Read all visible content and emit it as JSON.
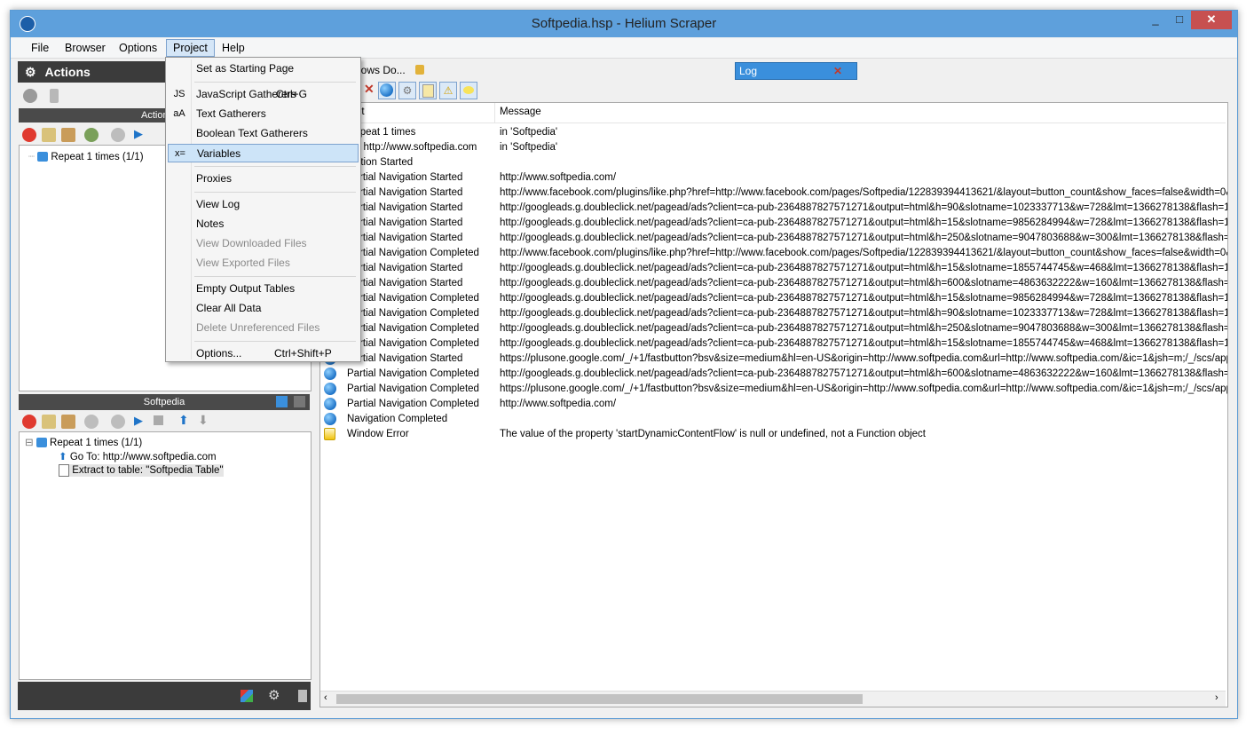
{
  "window": {
    "title": "Softpedia.hsp - Helium Scraper",
    "controls": {
      "minimize": "_",
      "maximize": "□",
      "close": "✕"
    }
  },
  "menubar": {
    "items": [
      "File",
      "Browser",
      "Options",
      "Project",
      "Help"
    ]
  },
  "left_panel": {
    "actions_title": "Actions",
    "tree_header": "Actions tre",
    "tree_items": [
      {
        "label": "Repeat 1 times (1/1)"
      }
    ],
    "sub_header": "Softpedia",
    "sub_tree": [
      {
        "label": "Repeat 1 times (1/1)"
      },
      {
        "label": "Go To: http://www.softpedia.com"
      },
      {
        "label": "Extract to table: \"Softpedia Table\""
      }
    ]
  },
  "tabs": [
    {
      "label": "dows Do..."
    },
    {
      "label": "Log"
    }
  ],
  "log": {
    "columns": {
      "event": "nt",
      "message": "Message"
    },
    "rows": [
      {
        "icon": "none",
        "event": "Repeat 1 times",
        "message": "in 'Softpedia'"
      },
      {
        "icon": "none",
        "event": "To: http://www.softpedia.com",
        "message": "in 'Softpedia'"
      },
      {
        "icon": "none",
        "event": "igation Started",
        "message": ""
      },
      {
        "icon": "globe",
        "event": "Partial Navigation Started",
        "message": "http://www.softpedia.com/"
      },
      {
        "icon": "globe",
        "event": "Partial Navigation Started",
        "message": "http://www.facebook.com/plugins/like.php?href=http://www.facebook.com/pages/Softpedia/122839394413621/&layout=button_count&show_faces=false&width=0&action"
      },
      {
        "icon": "globe",
        "event": "Partial Navigation Started",
        "message": "http://googleads.g.doubleclick.net/pagead/ads?client=ca-pub-2364887827571271&output=html&h=90&slotname=1023337713&w=728&lmt=1366278138&flash=11.7.700.16"
      },
      {
        "icon": "globe",
        "event": "Partial Navigation Started",
        "message": "http://googleads.g.doubleclick.net/pagead/ads?client=ca-pub-2364887827571271&output=html&h=15&slotname=9856284994&w=728&lmt=1366278138&flash=11.7.700.16"
      },
      {
        "icon": "globe",
        "event": "Partial Navigation Started",
        "message": "http://googleads.g.doubleclick.net/pagead/ads?client=ca-pub-2364887827571271&output=html&h=250&slotname=9047803688&w=300&lmt=1366278138&flash=11.7.700.1"
      },
      {
        "icon": "globe",
        "event": "Partial Navigation Completed",
        "message": "http://www.facebook.com/plugins/like.php?href=http://www.facebook.com/pages/Softpedia/122839394413621/&layout=button_count&show_faces=false&width=0&action"
      },
      {
        "icon": "globe",
        "event": "Partial Navigation Started",
        "message": "http://googleads.g.doubleclick.net/pagead/ads?client=ca-pub-2364887827571271&output=html&h=15&slotname=1855744745&w=468&lmt=1366278138&flash=11.7.700.16"
      },
      {
        "icon": "globe",
        "event": "Partial Navigation Started",
        "message": "http://googleads.g.doubleclick.net/pagead/ads?client=ca-pub-2364887827571271&output=html&h=600&slotname=4863632222&w=160&lmt=1366278138&flash=11.7.700.1"
      },
      {
        "icon": "globe",
        "event": "Partial Navigation Completed",
        "message": "http://googleads.g.doubleclick.net/pagead/ads?client=ca-pub-2364887827571271&output=html&h=15&slotname=9856284994&w=728&lmt=1366278138&flash=11.7.700.16"
      },
      {
        "icon": "globe",
        "event": "Partial Navigation Completed",
        "message": "http://googleads.g.doubleclick.net/pagead/ads?client=ca-pub-2364887827571271&output=html&h=90&slotname=1023337713&w=728&lmt=1366278138&flash=11.7.700.16"
      },
      {
        "icon": "globe",
        "event": "Partial Navigation Completed",
        "message": "http://googleads.g.doubleclick.net/pagead/ads?client=ca-pub-2364887827571271&output=html&h=250&slotname=9047803688&w=300&lmt=1366278138&flash=11.7.700.1"
      },
      {
        "icon": "globe",
        "event": "Partial Navigation Completed",
        "message": "http://googleads.g.doubleclick.net/pagead/ads?client=ca-pub-2364887827571271&output=html&h=15&slotname=1855744745&w=468&lmt=1366278138&flash=11.7.700.16"
      },
      {
        "icon": "globe",
        "event": "Partial Navigation Started",
        "message": "https://plusone.google.com/_/+1/fastbutton?bsv&size=medium&hl=en-US&origin=http://www.softpedia.com&url=http://www.softpedia.com/&ic=1&jsh=m;/_/scs/apps-static/"
      },
      {
        "icon": "globe",
        "event": "Partial Navigation Completed",
        "message": "http://googleads.g.doubleclick.net/pagead/ads?client=ca-pub-2364887827571271&output=html&h=600&slotname=4863632222&w=160&lmt=1366278138&flash=11.7.700.1"
      },
      {
        "icon": "globe",
        "event": "Partial Navigation Completed",
        "message": "https://plusone.google.com/_/+1/fastbutton?bsv&size=medium&hl=en-US&origin=http://www.softpedia.com&url=http://www.softpedia.com/&ic=1&jsh=m;/_/scs/apps-static/"
      },
      {
        "icon": "globe",
        "event": "Partial Navigation Completed",
        "message": "http://www.softpedia.com/"
      },
      {
        "icon": "globe",
        "event": "Navigation Completed",
        "message": ""
      },
      {
        "icon": "warning",
        "event": "Window Error",
        "message": "The value of the property 'startDynamicContentFlow' is null or undefined, not a Function object"
      }
    ]
  },
  "project_menu": {
    "items": [
      {
        "label": "Set as Starting Page",
        "shortcut": "",
        "icon": "",
        "disabled": false
      },
      {
        "sep": true
      },
      {
        "label": "JavaScript Gatherers",
        "shortcut": "Ctrl+G",
        "icon": "JS",
        "disabled": false
      },
      {
        "label": "Text Gatherers",
        "shortcut": "",
        "icon": "aA",
        "disabled": false
      },
      {
        "label": "Boolean Text Gatherers",
        "shortcut": "",
        "icon": "",
        "disabled": false
      },
      {
        "label": "Variables",
        "shortcut": "",
        "icon": "x=",
        "disabled": false,
        "highlighted": true
      },
      {
        "sep": true
      },
      {
        "label": "Proxies",
        "shortcut": "",
        "icon": "",
        "disabled": false
      },
      {
        "sep": true
      },
      {
        "label": "View Log",
        "shortcut": "",
        "icon": "",
        "disabled": false
      },
      {
        "label": "Notes",
        "shortcut": "",
        "icon": "",
        "disabled": false
      },
      {
        "label": "View Downloaded Files",
        "shortcut": "",
        "icon": "",
        "disabled": true
      },
      {
        "label": "View Exported Files",
        "shortcut": "",
        "icon": "",
        "disabled": true
      },
      {
        "sep": true
      },
      {
        "label": "Empty Output Tables",
        "shortcut": "",
        "icon": "",
        "disabled": false
      },
      {
        "label": "Clear All Data",
        "shortcut": "",
        "icon": "",
        "disabled": false
      },
      {
        "label": "Delete Unreferenced Files",
        "shortcut": "",
        "icon": "",
        "disabled": true
      },
      {
        "sep": true
      },
      {
        "label": "Options...",
        "shortcut": "Ctrl+Shift+P",
        "icon": "",
        "disabled": false
      }
    ]
  },
  "colors": {
    "titlebar": "#5ea0dc",
    "accent": "#3a8fdc",
    "dark_panel": "#3b3b3b",
    "close": "#c75050"
  }
}
